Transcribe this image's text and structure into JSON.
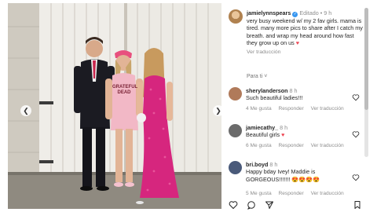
{
  "post": {
    "username": "jamielynnspears",
    "verified_icon": "verified-badge-icon",
    "edited": "Editado",
    "separator": "•",
    "time": "9 h",
    "caption": "very busy weekend w/ my 2 fav girls. mama is tired. many more pics to share after I catch my breath. and wrap my head around how fast they grow up on us",
    "caption_emoji": "♥",
    "see_translation": "Ver traducción"
  },
  "tagged_label": "Para ti",
  "comments": [
    {
      "username": "sherylanderson",
      "time": "8 h",
      "text": "Such beautiful ladies!!!",
      "likes": "4 Me gusta",
      "reply": "Responder",
      "translate": "Ver traducción",
      "avatar_color": "#b07a5a"
    },
    {
      "username": "jamiecathy_",
      "time": "8 h",
      "text": "Beautiful girls",
      "text_emoji": "♥",
      "likes": "6 Me gusta",
      "reply": "Responder",
      "translate": "Ver traducción",
      "avatar_color": "#6b6b6b"
    },
    {
      "username": "bri.boyd",
      "time": "8 h",
      "text": "Happy bday Ivey! Maddie is GORGEOUS!!!!!!!",
      "text_emoji": "😍😍😍😍",
      "likes": "5 Me gusta",
      "reply": "Responder",
      "translate": "Ver traducción",
      "avatar_color": "#4a5a7a"
    }
  ],
  "photo": {
    "shirt_text": "GRATEFUL DEAD",
    "nav_prev_icon": "chevron-left-icon",
    "nav_next_icon": "chevron-right-icon"
  },
  "actions": [
    "heart-icon",
    "comment-icon",
    "share-icon",
    "bookmark-icon"
  ],
  "colors": {
    "verified": "#3897f0",
    "muted": "#8e8e8e",
    "dress": "#d6267e",
    "shirt": "#f2b8c6",
    "cap": "#e8507e"
  }
}
